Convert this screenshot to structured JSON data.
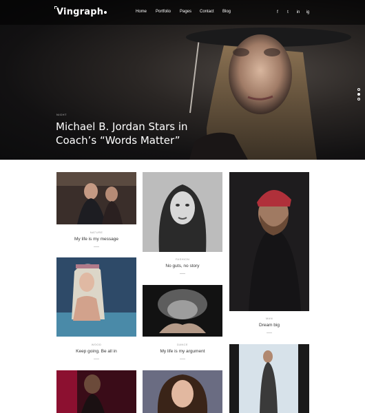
{
  "brand": {
    "name": "Vingraph"
  },
  "nav": {
    "items": [
      "Home",
      "Portfolio",
      "Pages",
      "Contact",
      "Blog"
    ]
  },
  "social": {
    "icons": [
      "facebook-icon",
      "twitter-icon",
      "linkedin-icon",
      "instagram-icon"
    ],
    "glyphs": [
      "f",
      "t",
      "in",
      "ig"
    ]
  },
  "hero": {
    "category": "NIGHT",
    "title": "Michael B. Jordan Stars in Coach’s “Words Matter”",
    "slides_total": 3,
    "slide_active": 1
  },
  "cards": [
    {
      "category": "NATURE",
      "title": "My life is my message"
    },
    {
      "category": "FASHION",
      "title": "No guts, no story"
    },
    {
      "category": "MAN",
      "title": "Dream big"
    },
    {
      "category": "WOOD",
      "title": "Keep going. Be all in"
    },
    {
      "category": "DANCE",
      "title": "My life is my argument"
    },
    {
      "category": "",
      "title": ""
    },
    {
      "category": "",
      "title": ""
    },
    {
      "category": "",
      "title": ""
    }
  ],
  "colors": {
    "hero_bg": "#0c0c0d",
    "text_dark": "#333333",
    "text_muted": "#999999"
  }
}
